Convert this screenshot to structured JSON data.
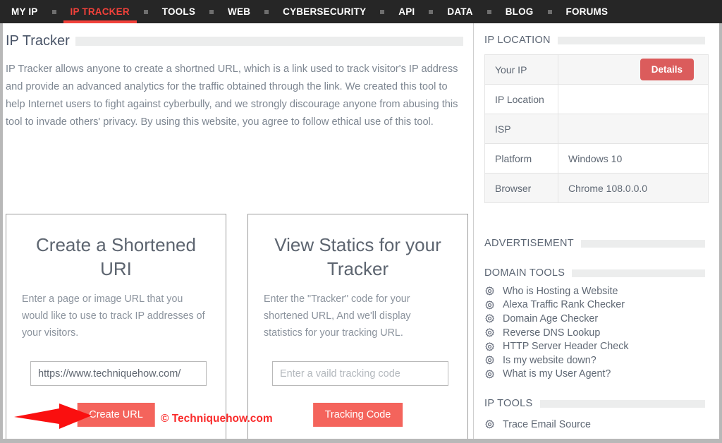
{
  "nav": {
    "items": [
      {
        "label": "MY IP",
        "active": false
      },
      {
        "label": "IP TRACKER",
        "active": true
      },
      {
        "label": "TOOLS",
        "active": false
      },
      {
        "label": "WEB",
        "active": false
      },
      {
        "label": "CYBERSECURITY",
        "active": false
      },
      {
        "label": "API",
        "active": false
      },
      {
        "label": "DATA",
        "active": false
      },
      {
        "label": "BLOG",
        "active": false
      },
      {
        "label": "FORUMS",
        "active": false
      }
    ]
  },
  "main": {
    "page_title": "IP Tracker",
    "intro": "IP Tracker allows anyone to create a shortned URL, which is a link used to track visitor's IP address and provide an advanced analytics for the traffic obtained through the link. We created this tool to help Internet users to fight against cyberbully, and we strongly discourage anyone from abusing this tool to invade others' privacy. By using this website, you agree to follow ethical use of this tool.",
    "cards": [
      {
        "title": "Create a Shortened URI",
        "description": "Enter a page or image URL that you would like to use to track IP addresses of your visitors.",
        "input_value": "https://www.techniquehow.com/",
        "input_placeholder": "",
        "button_label": "Create URL"
      },
      {
        "title": "View Statics for your Tracker",
        "description": "Enter the \"Tracker\" code for your shortened URL, And we'll display statistics for your tracking URL.",
        "input_value": "",
        "input_placeholder": "Enter a vaild tracking code",
        "button_label": "Tracking Code"
      }
    ]
  },
  "sidebar": {
    "ip_location": {
      "heading": "IP LOCATION",
      "details_button": "Details",
      "rows": [
        {
          "label": "Your IP",
          "value": ""
        },
        {
          "label": "IP Location",
          "value": ""
        },
        {
          "label": "ISP",
          "value": ""
        },
        {
          "label": "Platform",
          "value": "Windows 10"
        },
        {
          "label": "Browser",
          "value": "Chrome 108.0.0.0"
        }
      ]
    },
    "advertisement_heading": "ADVERTISEMENT",
    "domain_tools": {
      "heading": "DOMAIN TOOLS",
      "items": [
        "Who is Hosting a Website",
        "Alexa Traffic Rank Checker",
        "Domain Age Checker",
        "Reverse DNS Lookup",
        "HTTP Server Header Check",
        "Is my website down?",
        "What is my User Agent?"
      ]
    },
    "ip_tools": {
      "heading": "IP TOOLS",
      "items": [
        "Trace Email Source"
      ]
    }
  },
  "annotation": {
    "watermark": "© Techniquehow.com",
    "arrow_color": "#fa0f0f"
  },
  "colors": {
    "nav_bg": "#262626",
    "accent_red": "#f2413a",
    "button_red": "#f4645c",
    "details_red": "#db5c5c"
  }
}
